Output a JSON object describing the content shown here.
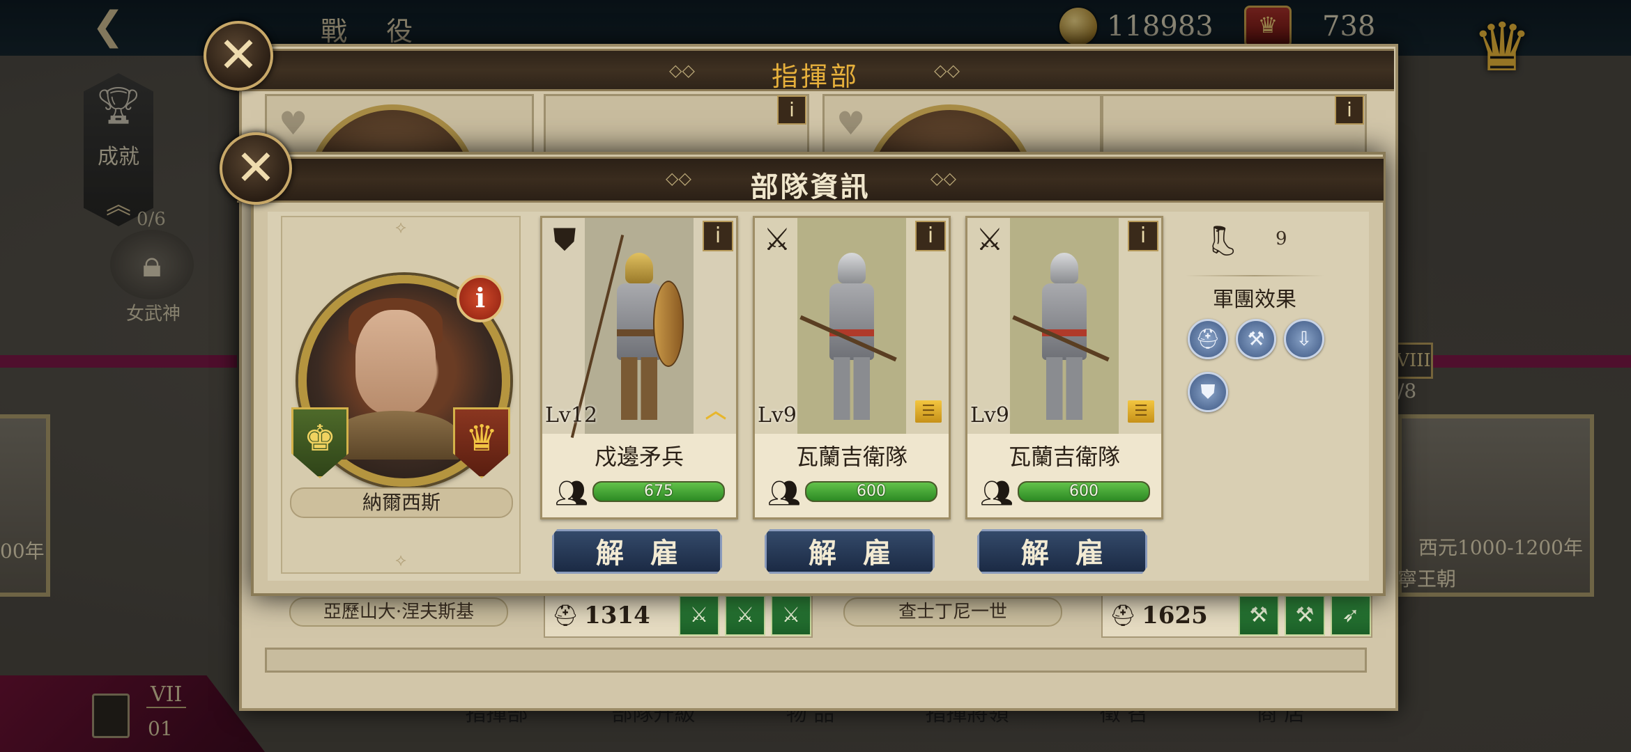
{
  "background": {
    "campaign_title": "戰 役",
    "gold": "118983",
    "crowns": "738",
    "achievements_label": "成就",
    "progress": "0/6",
    "goddess_label": "女武神",
    "left_card_year": "00年",
    "right_card_year": "西元1000-1200年",
    "right_card_dynasty": "寧王朝",
    "right_card_roman": "VIII",
    "right_card_progress": "/8",
    "save_roman": "VII",
    "save_chapter": "01",
    "bottom_tabs": [
      "指揮部",
      "部隊升級",
      "物 品",
      "指揮將領",
      "徵 召",
      "商 店"
    ]
  },
  "headquarters": {
    "title": "指揮部",
    "commander_left_name": "亞歷山大·涅夫斯基",
    "commander_left_power": "1314",
    "commander_right_name": "查士丁尼一世",
    "commander_right_power": "1625"
  },
  "troop_info": {
    "title": "部隊資訊",
    "leader_name": "納爾西斯",
    "speed": "9",
    "legion_effects_title": "軍團效果",
    "dismiss_label": "解雇",
    "units": [
      {
        "name": "戍邊矛兵",
        "level": "Lv12",
        "troops": "675",
        "troops_fraction": 1.0
      },
      {
        "name": "瓦蘭吉衛隊",
        "level": "Lv9",
        "troops": "600",
        "troops_fraction": 1.0
      },
      {
        "name": "瓦蘭吉衛隊",
        "level": "Lv9",
        "troops": "600",
        "troops_fraction": 1.0
      }
    ]
  },
  "icons": {
    "close": "close-icon",
    "info": "info-icon",
    "shield": "shield-type-icon",
    "swords": "crossed-swords-icon",
    "boot": "boot-speed-icon",
    "troops": "troops-icon"
  },
  "colors": {
    "header_gold": "#e6b03c",
    "hp_green": "#2d8a24",
    "dismiss_blue": "#1b2a44"
  }
}
